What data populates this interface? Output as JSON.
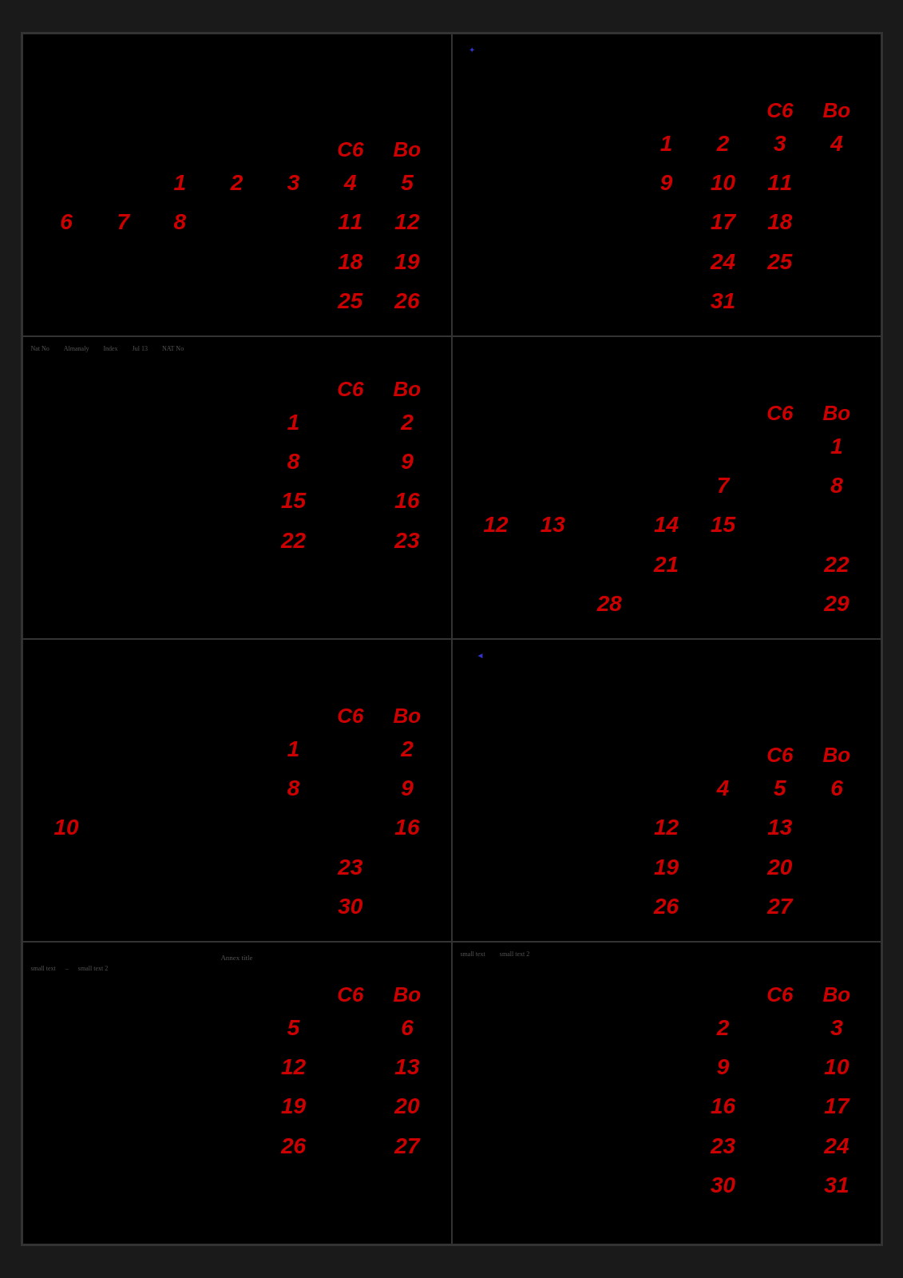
{
  "calendars": [
    {
      "id": "cal1",
      "labels": {
        "col1": "C6",
        "col2": "Bo"
      },
      "days": [
        "",
        "",
        "",
        "",
        "",
        "C6",
        "Bo",
        "",
        "",
        "1",
        "2",
        "3",
        "4",
        "5",
        "6",
        "7",
        "8",
        "",
        "",
        "11",
        "12",
        "",
        "",
        "",
        "",
        "",
        "18",
        "19",
        "",
        "",
        "",
        "",
        "",
        "25",
        "26"
      ]
    },
    {
      "id": "cal2",
      "labels": {
        "col1": "C6",
        "col2": "Bo"
      },
      "days": [
        "",
        "",
        "",
        "",
        "C6",
        "Bo",
        "",
        "",
        "",
        "1",
        "2",
        "3",
        "4",
        "",
        "",
        "",
        "9",
        "10",
        "11",
        "",
        "",
        "",
        "",
        "",
        "17",
        "18",
        "",
        "",
        "",
        "",
        "24",
        "25",
        "",
        "",
        "",
        "",
        "31",
        "",
        "",
        "",
        "",
        ""
      ]
    },
    {
      "id": "cal3",
      "smallLabels": [
        "Nat No",
        "Almanaly",
        "Index",
        "Jul 13",
        "NAT No"
      ],
      "labels": {
        "col1": "C6",
        "col2": "Bo"
      },
      "days": [
        "",
        "",
        "",
        "",
        "",
        "C6",
        "Bo",
        "",
        "",
        "",
        "",
        "1",
        "",
        "2",
        "",
        "",
        "",
        "",
        "8",
        "",
        "9",
        "",
        "",
        "",
        "",
        "15",
        "",
        "16",
        "",
        "",
        "",
        "",
        "22",
        "",
        "23"
      ]
    },
    {
      "id": "cal4",
      "labels": {
        "col1": "C6",
        "col2": "Bo"
      },
      "days": [
        "",
        "",
        "",
        "",
        "",
        "C6",
        "Bo",
        "",
        "",
        "",
        "",
        "",
        "",
        "1",
        "",
        "",
        "",
        "7",
        "",
        "",
        "8",
        "12",
        "13",
        "14",
        "",
        "15",
        "",
        "",
        "",
        "",
        "",
        "21",
        "",
        "",
        "22",
        "",
        "",
        "28",
        "",
        "",
        "",
        "29"
      ]
    },
    {
      "id": "cal5",
      "labels": {
        "col1": "C6",
        "col2": "Bo"
      },
      "days": [
        "",
        "",
        "",
        "",
        "",
        "C6",
        "Bo",
        "",
        "",
        "",
        "",
        "1",
        "",
        "2",
        "",
        "",
        "",
        "",
        "8",
        "",
        "9",
        "10",
        "",
        "",
        "",
        "",
        "",
        "16",
        "",
        "",
        "",
        "",
        "",
        "23",
        "",
        "",
        "",
        "",
        "",
        "",
        "30",
        ""
      ]
    },
    {
      "id": "cal6",
      "labels": {
        "col1": "C6",
        "col2": "Bo"
      },
      "days": [
        "",
        "",
        "",
        "",
        "C6",
        "Bo",
        "",
        "",
        "",
        "",
        "4",
        "5",
        "6",
        "",
        "",
        "",
        "12",
        "",
        "13",
        "",
        "",
        "",
        "",
        "19",
        "",
        "20",
        "",
        "",
        "",
        "",
        "26",
        "",
        "27",
        "",
        ""
      ]
    },
    {
      "id": "cal7",
      "monthTitle": "Annex title",
      "smallLabels": [
        "small text",
        "–",
        "small text 2"
      ],
      "labels": {
        "col1": "C6",
        "col2": "Bo"
      },
      "days": [
        "",
        "",
        "",
        "",
        "",
        "C6",
        "Bo",
        "",
        "",
        "",
        "",
        "5",
        "",
        "6",
        "",
        "",
        "",
        "",
        "12",
        "",
        "13",
        "",
        "",
        "",
        "",
        "19",
        "",
        "20",
        "",
        "",
        "",
        "",
        "26",
        "",
        "27"
      ]
    },
    {
      "id": "cal8",
      "smallLabels": [
        "small text",
        "small text 2"
      ],
      "labels": {
        "col1": "C6",
        "col2": "Bo"
      },
      "days": [
        "",
        "",
        "",
        "",
        "",
        "C6",
        "Bo",
        "",
        "",
        "",
        "",
        "2",
        "",
        "3",
        "",
        "",
        "",
        "",
        "9",
        "",
        "10",
        "",
        "",
        "",
        "",
        "16",
        "",
        "17",
        "",
        "",
        "",
        "",
        "23",
        "",
        "24",
        "",
        "",
        "",
        "",
        "30",
        "",
        "31"
      ]
    }
  ]
}
